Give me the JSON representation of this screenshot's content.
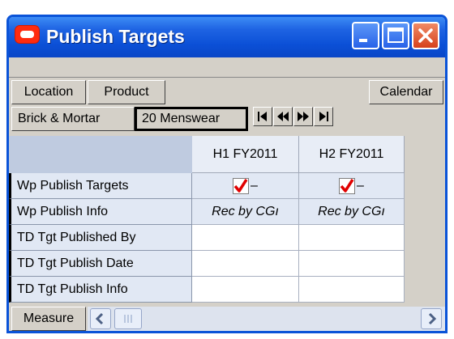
{
  "window": {
    "title": "Publish Targets"
  },
  "toolbar": {
    "location_label": "Location",
    "product_label": "Product",
    "calendar_label": "Calendar"
  },
  "selection": {
    "location": "Brick & Mortar",
    "product": "20 Menswear"
  },
  "grid": {
    "columns": [
      "H1 FY2011",
      "H2 FY2011"
    ],
    "rows": [
      {
        "label": "Wp Publish Targets",
        "h1": "–",
        "h2": "–"
      },
      {
        "label": "Wp Publish Info",
        "h1": "Rec by CGı",
        "h2": "Rec by CGı"
      },
      {
        "label": "TD Tgt Published By",
        "h1": "",
        "h2": ""
      },
      {
        "label": "TD Tgt Publish Date",
        "h1": "",
        "h2": ""
      },
      {
        "label": "TD Tgt Publish Info",
        "h1": "",
        "h2": ""
      }
    ]
  },
  "footer": {
    "measure_label": "Measure"
  },
  "icons": {
    "nav_first": "first-page-icon",
    "nav_prev": "prev-page-icon",
    "nav_next": "next-page-icon",
    "nav_last": "last-page-icon"
  }
}
